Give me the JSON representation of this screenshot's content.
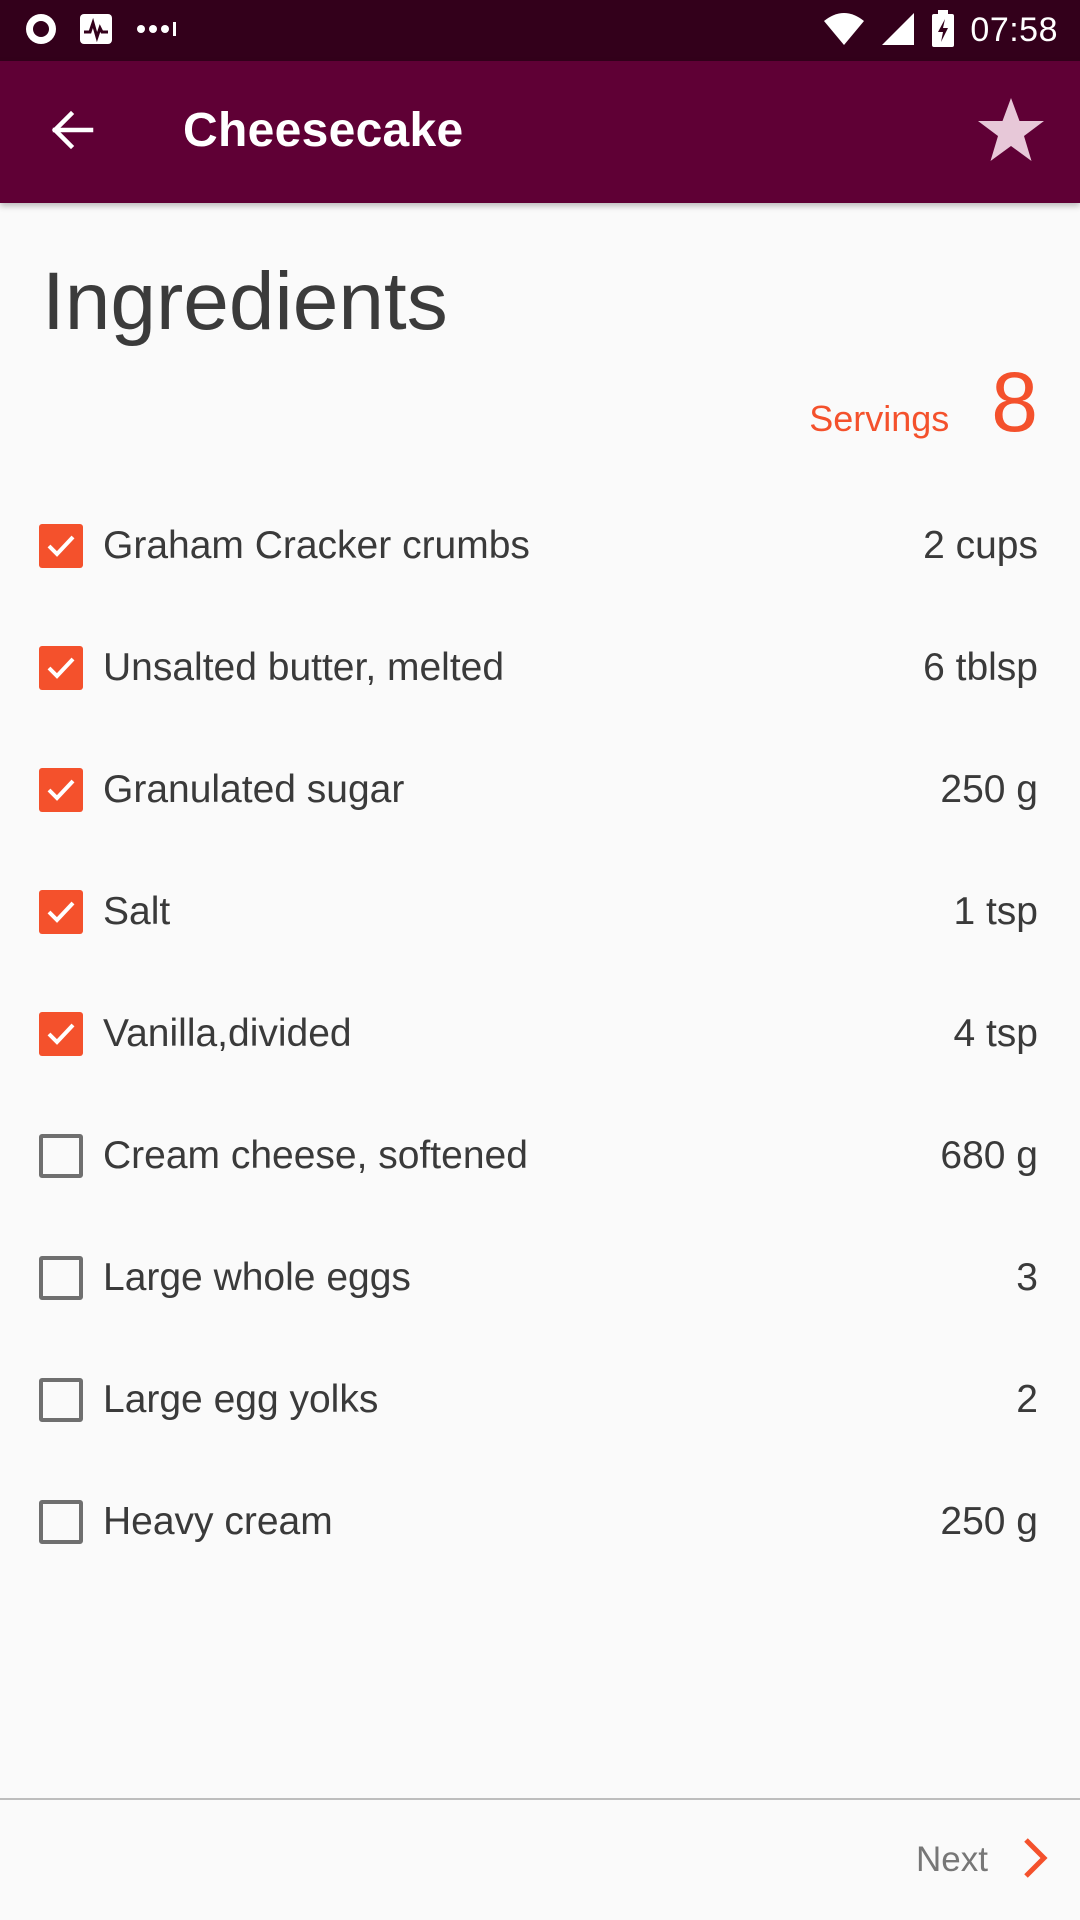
{
  "status_bar": {
    "time": "07:58",
    "icons": [
      "record-icon",
      "activity-icon",
      "more-dots-icon",
      "wifi-icon",
      "signal-icon",
      "battery-charging-icon"
    ]
  },
  "app_bar": {
    "title": "Cheesecake",
    "back_icon": "arrow-left-icon",
    "favorite_icon": "star-icon"
  },
  "main": {
    "heading": "Ingredients",
    "servings_label": "Servings",
    "servings_value": "8",
    "ingredients": [
      {
        "name": "Graham Cracker crumbs",
        "qty": "2 cups",
        "checked": true
      },
      {
        "name": "Unsalted butter, melted",
        "qty": "6 tblsp",
        "checked": true
      },
      {
        "name": "Granulated sugar",
        "qty": "250 g",
        "checked": true
      },
      {
        "name": "Salt",
        "qty": "1 tsp",
        "checked": true
      },
      {
        "name": "Vanilla,divided",
        "qty": "4 tsp",
        "checked": true
      },
      {
        "name": "Cream cheese, softened",
        "qty": "680 g",
        "checked": false
      },
      {
        "name": "Large whole eggs",
        "qty": "3",
        "checked": false
      },
      {
        "name": "Large egg yolks",
        "qty": "2",
        "checked": false
      },
      {
        "name": "Heavy cream",
        "qty": "250 g",
        "checked": false
      }
    ]
  },
  "footer": {
    "next_label": "Next",
    "next_icon": "chevron-right-icon"
  },
  "colors": {
    "status_bar": "#33001b",
    "app_bar": "#5f0035",
    "accent": "#f4512c",
    "background": "#fafafa"
  }
}
